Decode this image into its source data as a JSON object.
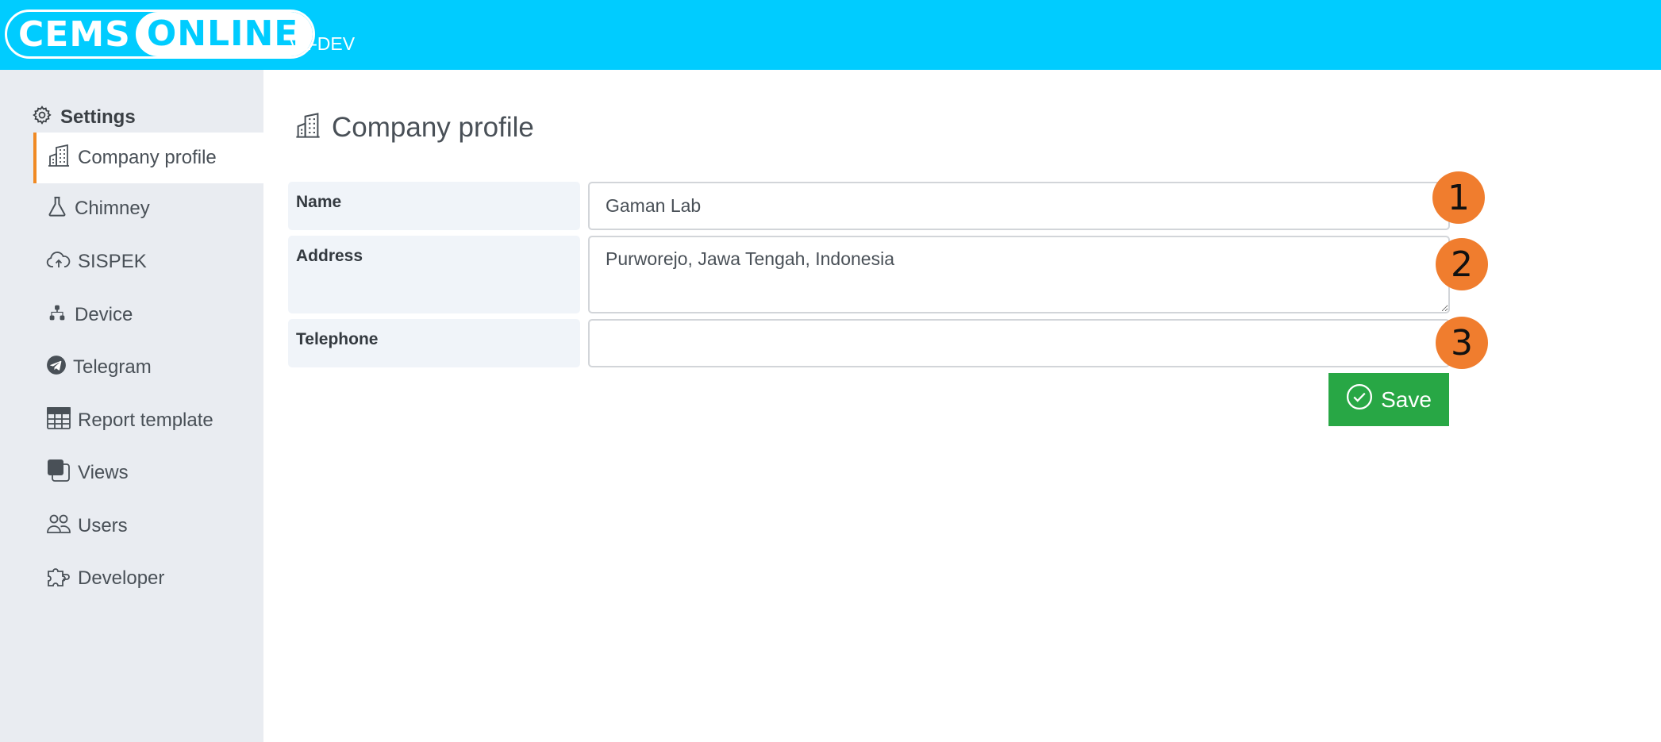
{
  "header": {
    "logo_part1": "CEMS",
    "logo_part2": "ONLINE",
    "version": "V1-DEV",
    "bg_color": "#00ccff"
  },
  "sidebar": {
    "title": "Settings",
    "title_icon": "gear-icon",
    "items": [
      {
        "label": "Company profile",
        "icon": "building-icon",
        "active": true
      },
      {
        "label": "Chimney",
        "icon": "flask-icon"
      },
      {
        "label": "SISPEK",
        "icon": "cloud-upload-icon"
      },
      {
        "label": "Device",
        "icon": "diagram-icon"
      },
      {
        "label": "Telegram",
        "icon": "telegram-icon"
      },
      {
        "label": "Report template",
        "icon": "table-icon"
      },
      {
        "label": "Views",
        "icon": "stack-icon"
      },
      {
        "label": "Users",
        "icon": "people-icon"
      },
      {
        "label": "Developer",
        "icon": "puzzle-icon"
      }
    ]
  },
  "main": {
    "title": "Company profile",
    "fields": {
      "name": {
        "label": "Name",
        "value": "Gaman Lab"
      },
      "address": {
        "label": "Address",
        "value": "Purworejo, Jawa Tengah, Indonesia"
      },
      "telephone": {
        "label": "Telephone",
        "value": ""
      }
    },
    "save_label": "Save"
  },
  "annotations": [
    "1",
    "2",
    "3"
  ],
  "colors": {
    "accent": "#f08a24",
    "save": "#28a745",
    "marker": "#f07d2e"
  }
}
